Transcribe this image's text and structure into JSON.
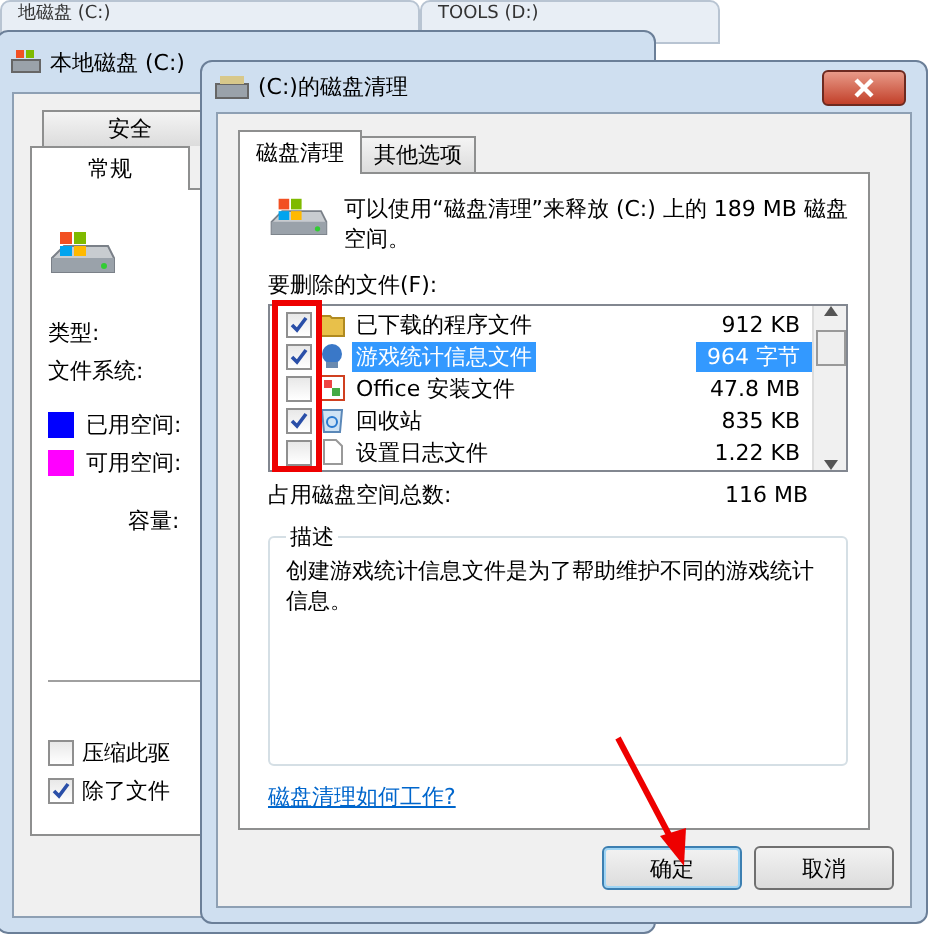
{
  "background_windows": [
    {
      "title": "地磁盘 (C:)"
    },
    {
      "title": "TOOLS (D:)"
    }
  ],
  "properties_window": {
    "title": "本地磁盘 (C:)",
    "tabs_back": [
      {
        "label": "安全",
        "selected": false
      }
    ],
    "tabs": [
      {
        "label": "常规",
        "selected": true
      }
    ],
    "fields": [
      {
        "label": "类型:"
      },
      {
        "label": "文件系统:"
      }
    ],
    "legend": [
      {
        "label": "已用空间:",
        "color": "#0000ff"
      },
      {
        "label": "可用空间:",
        "color": "#ff00ff"
      }
    ],
    "capacity_label": "容量:",
    "options": [
      {
        "label": "压缩此驱",
        "checked": false
      },
      {
        "label": "除了文件",
        "checked": true
      }
    ]
  },
  "cleanup_dialog": {
    "title": "(C:)的磁盘清理",
    "tabs": [
      {
        "label": "磁盘清理",
        "selected": true
      },
      {
        "label": "其他选项",
        "selected": false
      }
    ],
    "intro": "可以使用“磁盘清理”来释放  (C:) 上的 189 MB 磁盘空间。",
    "files_label": "要删除的文件(F):",
    "files": [
      {
        "kind": "folder",
        "name": "已下载的程序文件",
        "size": "912 KB",
        "checked": true,
        "selected": false
      },
      {
        "kind": "game",
        "name": "游戏统计信息文件",
        "size": "964 字节",
        "checked": true,
        "selected": true
      },
      {
        "kind": "office",
        "name": "Office 安装文件",
        "size": "47.8 MB",
        "checked": false,
        "selected": false
      },
      {
        "kind": "recycle",
        "name": "回收站",
        "size": "835 KB",
        "checked": true,
        "selected": false
      },
      {
        "kind": "document",
        "name": "设置日志文件",
        "size": "1.22 KB",
        "checked": false,
        "selected": false
      }
    ],
    "total_label": "占用磁盘空间总数:",
    "total": "116 MB",
    "description_title": "描述",
    "description": "创建游戏统计信息文件是为了帮助维护不同的游戏统计信息。",
    "help_link": "磁盘清理如何工作?",
    "buttons": [
      "确定",
      "取消"
    ]
  }
}
